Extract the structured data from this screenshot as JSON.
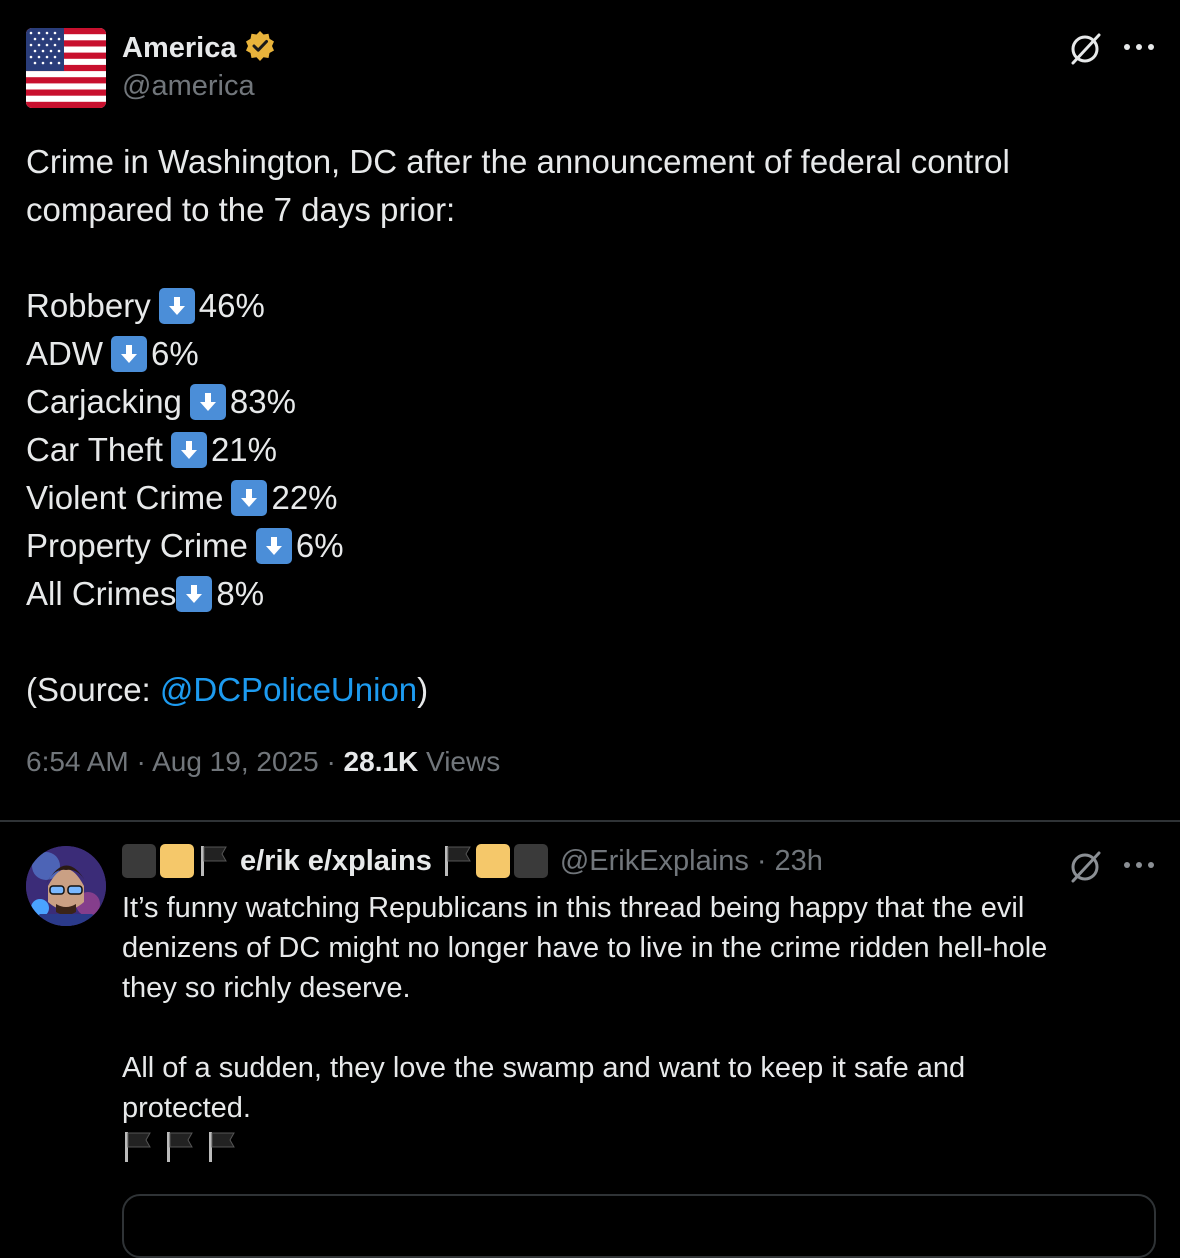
{
  "post": {
    "display_name": "America",
    "handle": "@america",
    "lines": [
      "Crime in Washington, DC after the announcement of federal control",
      "compared to the 7 days prior:"
    ],
    "stats": [
      {
        "label": "Robbery",
        "value": "46%"
      },
      {
        "label": "ADW",
        "value": "6%"
      },
      {
        "label": "Carjacking",
        "value": "83%"
      },
      {
        "label": "Car Theft",
        "value": "21%"
      },
      {
        "label": "Violent Crime",
        "value": "22%"
      },
      {
        "label": "Property Crime",
        "value": "6%"
      },
      {
        "label": "All Crimes",
        "value": "8%"
      }
    ],
    "source_prefix": "(Source: ",
    "source_mention": "@DCPoliceUnion",
    "source_suffix": ")",
    "time": "6:54 AM · Aug 19, 2025 · ",
    "views_count": "28.1K",
    "views_label": " Views",
    "icons": {
      "verified": "verified-badge-icon",
      "grok": "grok-icon",
      "more": "more-icon",
      "arrow": "down-arrow-icon"
    },
    "colors": {
      "verified": "#e8b33b",
      "link": "#1d9bf0",
      "arrow_box": "#4b8ed8"
    }
  },
  "reply": {
    "display_name": "e/rik e/xplains",
    "handle": "@ErikExplains",
    "time": "· 23h",
    "lines": [
      "It’s funny watching Republicans in this thread being happy that the evil",
      "denizens of DC might no longer have to live in the crime ridden hell-hole",
      "they so richly deserve."
    ],
    "lines2": [
      "All of a sudden, they love the swamp and want to keep it safe and",
      "protected."
    ]
  }
}
